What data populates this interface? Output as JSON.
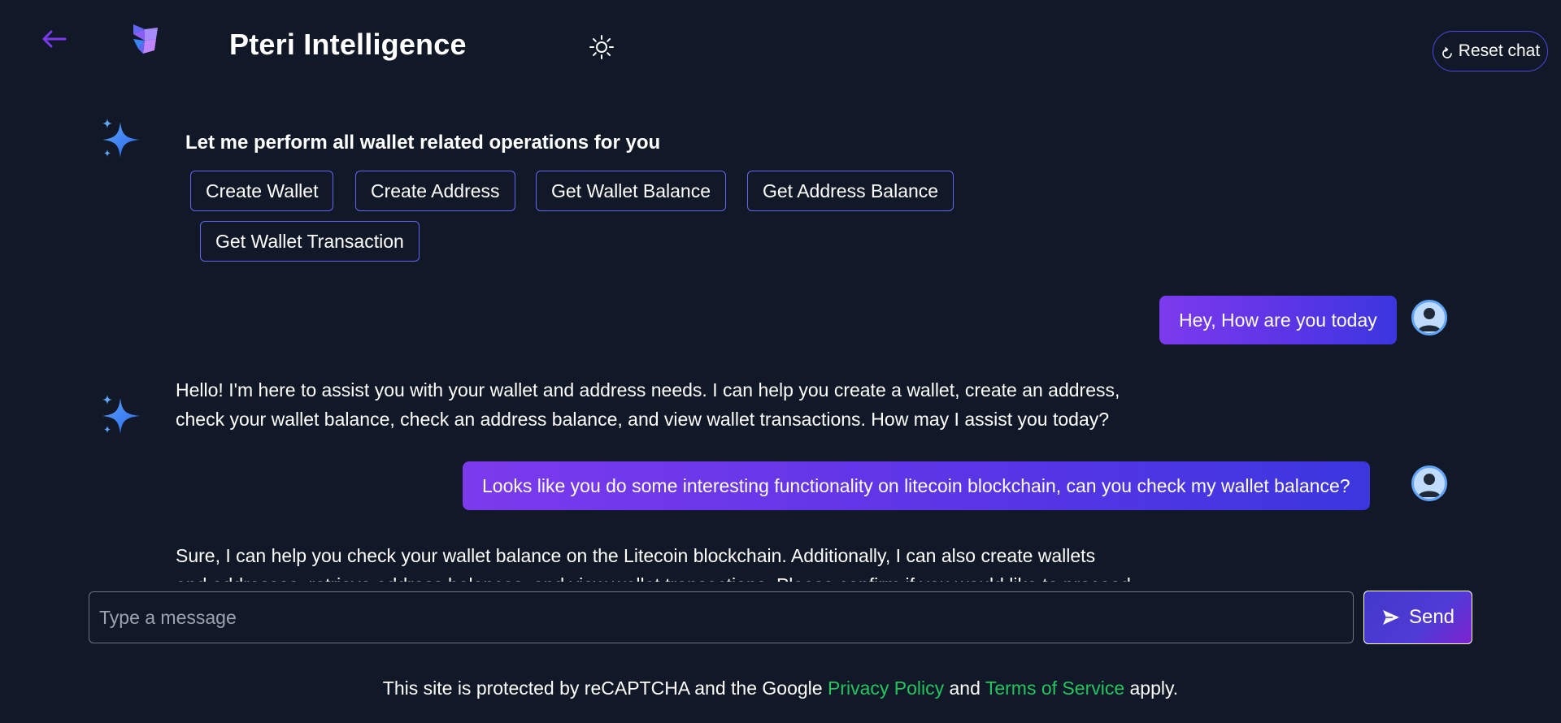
{
  "header": {
    "title": "Pteri Intelligence",
    "back_icon": "arrow-left-icon",
    "theme_icon": "sun-icon",
    "reset_label": "Reset chat",
    "reset_icon": "refresh-icon"
  },
  "chat": {
    "intro": "Let me perform all wallet related operations for you",
    "quick_actions": [
      "Create Wallet",
      "Create Address",
      "Get Wallet Balance",
      "Get Address Balance",
      "Get Wallet Transaction"
    ],
    "messages": [
      {
        "role": "user",
        "text": "Hey, How are you today"
      },
      {
        "role": "bot",
        "line1": "Hello! I'm here to assist you with your wallet and address needs. I can help you create a wallet, create an address,",
        "line2": "check your wallet balance, check an address balance, and view wallet transactions. How may I assist you today?"
      },
      {
        "role": "user",
        "text": "Looks like you do some interesting functionality on litecoin blockchain, can you check my wallet balance?"
      },
      {
        "role": "bot",
        "line1": "Sure, I can help you check your wallet balance on the Litecoin blockchain. Additionally, I can also create wallets",
        "line2": "and addresses, retrieve address balances, and view wallet transactions. Please confirm if you would like to proceed."
      }
    ]
  },
  "composer": {
    "placeholder": "Type a message",
    "send_label": "Send"
  },
  "footer": {
    "prefix": "This site is protected by reCAPTCHA and the Google ",
    "privacy": "Privacy Policy",
    "and": " and ",
    "terms": "Terms of Service",
    "suffix": " apply."
  },
  "colors": {
    "background": "#111827",
    "accent": "#7c3aed",
    "link": "#22c55e",
    "button_border": "#6366f1"
  }
}
